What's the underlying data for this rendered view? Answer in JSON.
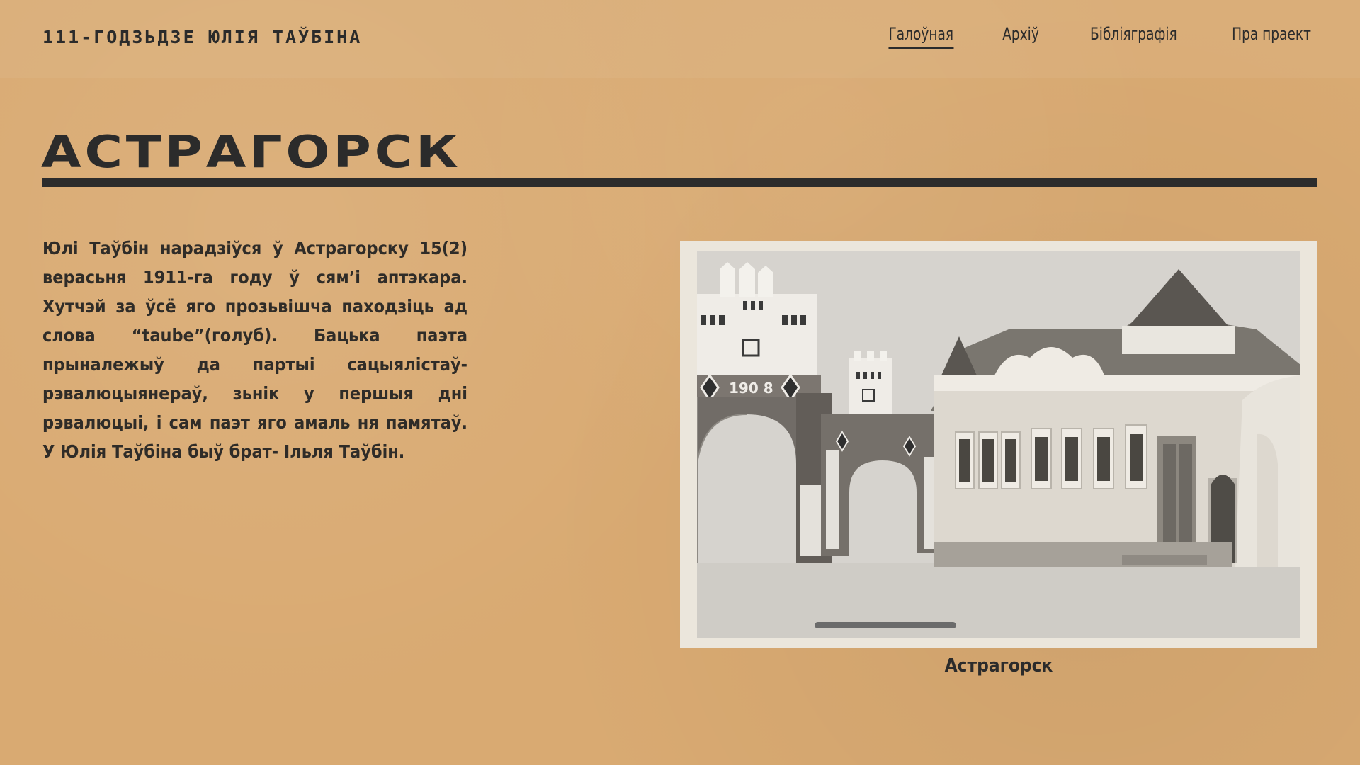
{
  "header": {
    "site_title": "111-ГОДЗЬДЗЕ ЮЛІЯ ТАЎБІНА",
    "nav": [
      {
        "label": "Галоўная",
        "active": true
      },
      {
        "label": "Архіў",
        "active": false
      },
      {
        "label": "Бібліяграфія",
        "active": false
      },
      {
        "label": "Пра праект",
        "active": false
      }
    ]
  },
  "main": {
    "heading": "АСТРАГОРСК",
    "bio": "Юлі Таўбін нарадзіўся ў Астрагорску 15(2) верасьня 1911-га году ў сям’і аптэкара. Хутчэй за ўсё яго прозьвішча паходзіць ад слова “taube”(голуб). Бацька паэта прыналежыў да партыі сацыялістаў-рэвалюцыянераў, зьнік у першыя дні рэвалюцыі, і сам паэт яго амаль ня памятаў. У Юлія Таўбіна быў брат- Ільля Таўбін.",
    "photo": {
      "arch_year": "190 8",
      "caption": "Астрагорск"
    }
  },
  "colors": {
    "background": "#d9aa72",
    "text": "#2b2b2b",
    "rule": "#2c2c2c",
    "frame": "#ebe6dc",
    "photo_bg": "#d6d3ce"
  }
}
